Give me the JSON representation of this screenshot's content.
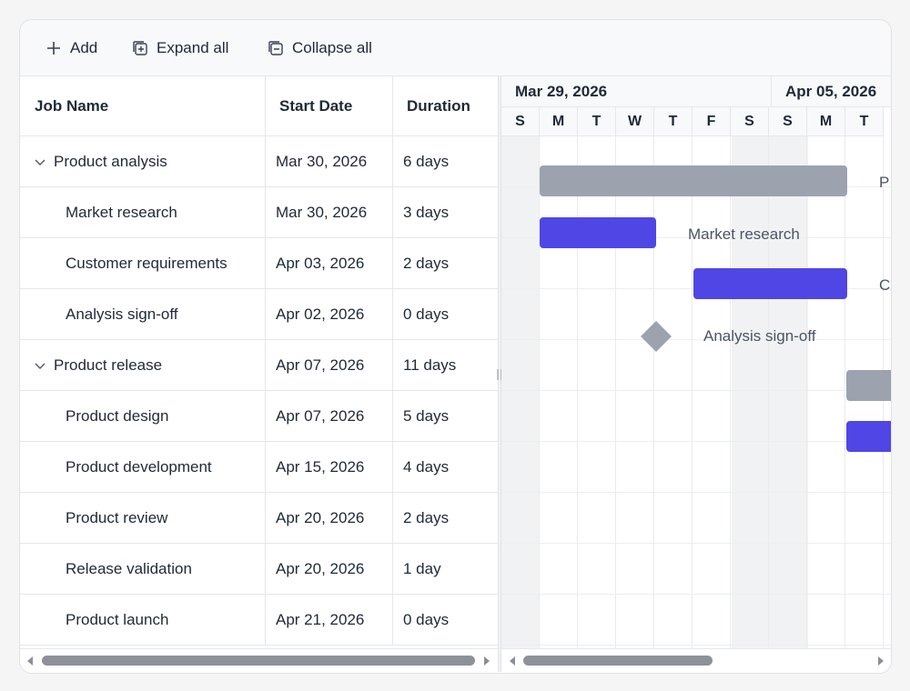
{
  "toolbar": {
    "add_label": "Add",
    "expand_label": "Expand all",
    "collapse_label": "Collapse all"
  },
  "grid": {
    "columns": [
      "Job Name",
      "Start Date",
      "Duration"
    ],
    "rows": [
      {
        "name": "Product analysis",
        "start": "Mar 30, 2026",
        "duration": "6 days",
        "level": 0,
        "expanded": true
      },
      {
        "name": "Market research",
        "start": "Mar 30, 2026",
        "duration": "3 days",
        "level": 1
      },
      {
        "name": "Customer requirements",
        "start": "Apr 03, 2026",
        "duration": "2 days",
        "level": 1
      },
      {
        "name": "Analysis sign-off",
        "start": "Apr 02, 2026",
        "duration": "0 days",
        "level": 1
      },
      {
        "name": "Product release",
        "start": "Apr 07, 2026",
        "duration": "11 days",
        "level": 0,
        "expanded": true
      },
      {
        "name": "Product design",
        "start": "Apr 07, 2026",
        "duration": "5 days",
        "level": 1
      },
      {
        "name": "Product development",
        "start": "Apr 15, 2026",
        "duration": "4 days",
        "level": 1
      },
      {
        "name": "Product review",
        "start": "Apr 20, 2026",
        "duration": "2 days",
        "level": 1
      },
      {
        "name": "Release validation",
        "start": "Apr 20, 2026",
        "duration": "1 day",
        "level": 1
      },
      {
        "name": "Product launch",
        "start": "Apr 21, 2026",
        "duration": "0 days",
        "level": 1
      }
    ]
  },
  "timeline": {
    "weeks": [
      "Mar 29, 2026",
      "Apr 05, 2026"
    ],
    "days": [
      "S",
      "M",
      "T",
      "W",
      "T",
      "F",
      "S",
      "S",
      "M",
      "T"
    ],
    "bar_labels": {
      "product_analysis": "P",
      "market_research": "Market research",
      "customer_requirements": "C",
      "analysis_signoff": "Analysis sign-off"
    }
  },
  "colors": {
    "task_bar": "#4f46e5",
    "summary_bar": "#9ca3af",
    "weekend": "#f1f2f4"
  }
}
